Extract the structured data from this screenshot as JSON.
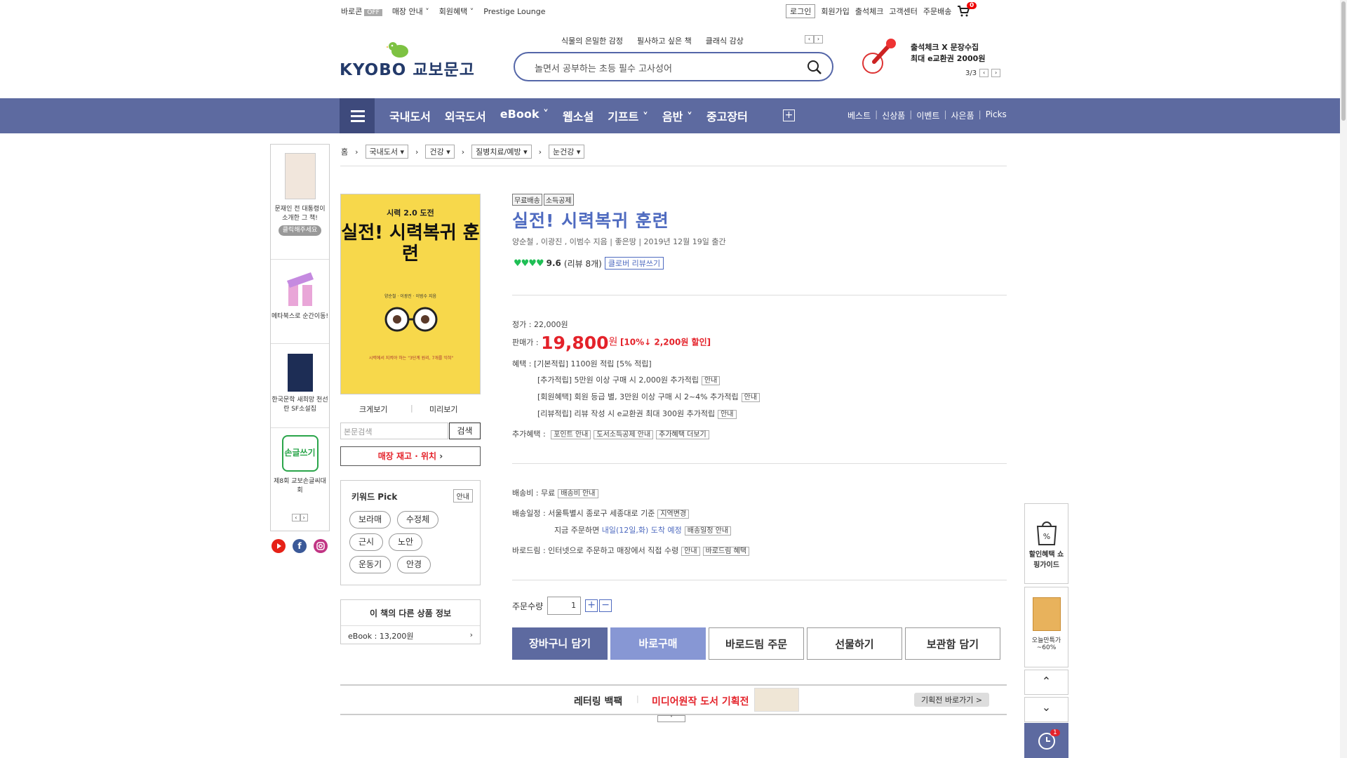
{
  "util": {
    "barocon": "바로콘",
    "barocon_state": "OFF",
    "store_guide": "매장 안내",
    "member_benefit": "회원혜택",
    "prestige": "Prestige Lounge",
    "login": "로그인",
    "join": "회원가입",
    "attendance": "출석체크",
    "customer": "고객센터",
    "order_delivery": "주문배송",
    "cart_count": "0"
  },
  "logo": {
    "en": "KYOBO",
    "ko": "교보문고"
  },
  "keywords": [
    "식물의 은밀한 감정",
    "필사하고 싶은 책",
    "클래식 감상"
  ],
  "search": {
    "placeholder": "놀면서 공부하는 초등 필수 고사성어"
  },
  "promo": {
    "line1": "출석체크 X 문장수집",
    "line2": "최대 e교환권 2000원",
    "page": "3/3"
  },
  "nav": {
    "items": [
      "국내도서",
      "외국도서",
      "eBook",
      "웹소설",
      "기프트",
      "음반",
      "중고장터"
    ],
    "right": [
      "베스트",
      "신상품",
      "이벤트",
      "사은품",
      "Picks"
    ]
  },
  "left_banner": {
    "item1": "문재인 전 대통령이 소개한 그 책!",
    "item1_btn": "클릭해주세요",
    "item2": "메타북스로 순간이동!",
    "item3": "한국문학 새희망 천선란 SF소설집",
    "item4": "제8회 교보손글씨대회",
    "item4_logo": "손글쓰기"
  },
  "breadcrumb": {
    "home": "홈",
    "c1": "국내도서",
    "c2": "건강",
    "c3": "질병치료/예방",
    "c4": "눈건강"
  },
  "cover": {
    "top": "시력 2.0 도전",
    "title": "실전! 시력복귀 훈련",
    "authors": "양순철 · 이광진 · 이범수 지음",
    "tagline": "시력에서 지켜야 하는 \"3단계 원리, 7개를 익혀\""
  },
  "left_tools": {
    "zoom": "크게보기",
    "preview": "미리보기",
    "search_placeholder": "본문검색",
    "search_btn": "검색",
    "store": "매장 재고 · 위치"
  },
  "keyword_pick": {
    "title": "키워드 Pick",
    "guide": "안내",
    "tags": [
      "보라매",
      "수정체",
      "근시",
      "노안",
      "운동기",
      "안경"
    ]
  },
  "other_info": {
    "title": "이 책의 다른 상품 정보",
    "ebook": "eBook : 13,200원"
  },
  "product": {
    "badges": [
      "무료배송",
      "소득공제"
    ],
    "title": "실전! 시력복귀 훈련",
    "meta": "양순철 , 이광진 , 이범수 지음 | 좋은땅 | 2019년 12월 19일 출간",
    "rating": "9.6",
    "review_count": "(리뷰 8개)",
    "review_btn": "클로버 리뷰쓰기",
    "rating_hearts": 4
  },
  "price": {
    "list_label": "정가 : ",
    "list": "22,000원",
    "sale_label": "판매가 : ",
    "sale": "19,800",
    "won": "원",
    "discount": "[10%↓ 2,200원 할인]",
    "benefit_label": "혜택 : ",
    "basic": "[기본적립] 1100원 적립 [5% 적립]",
    "add": "[추가적립] 5만원 이상 구매 시 2,000원 추가적립",
    "member": "[회원혜택] 회원 등급 별, 3만원 이상 구매 시 2~4% 추가적립",
    "review": "[리뷰적립] 리뷰 작성 시 e교환권 최대 300원 추가적립",
    "guide": "안내",
    "extra_label": "추가혜택 : ",
    "extra": [
      "포인트 안내",
      "도서소득공제 안내",
      "추가혜택 더보기"
    ]
  },
  "delivery": {
    "fee": "배송비 : 무료",
    "fee_btn": "배송비 안내",
    "schedule": "배송일정 : 서울특별시 종로구 세종대로 기준",
    "region_btn": "지역변경",
    "now": "지금 주문하면",
    "eta": "내일(12일,화) 도착 예정",
    "schedule_btn": "배송일정 안내",
    "barodrim": "바로드림 : 인터넷으로 주문하고 매장에서 직접 수령",
    "guide": "안내",
    "barodrim_btn": "바로드림 혜택"
  },
  "order": {
    "qty_label": "주문수량",
    "qty": "1",
    "buttons": [
      "장바구니 담기",
      "바로구매",
      "바로드림 주문",
      "선물하기",
      "보관함 담기"
    ]
  },
  "bottom_banner": {
    "a": "레터링 백팩",
    "b": "미디어원작 도서 기획전",
    "go": "기획전 바로가기 >"
  },
  "right_float": {
    "guide": "할인혜택 쇼핑가이드",
    "today": "오늘만특가 ~60%",
    "history_count": "1"
  },
  "colors": {
    "nav": "#5d6aa0",
    "accent": "#4f6bc0",
    "price": "#e4222a"
  }
}
